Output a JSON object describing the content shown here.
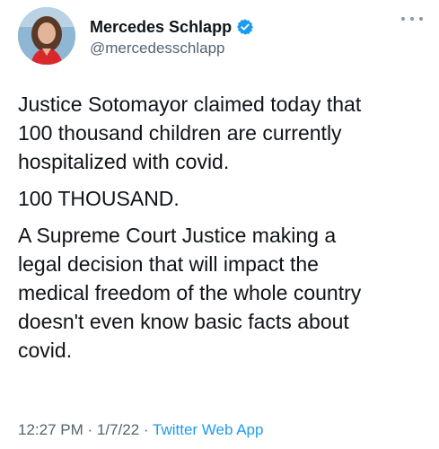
{
  "author": {
    "display_name": "Mercedes Schlapp",
    "handle": "@mercedesschlapp",
    "verified_icon": "verified-badge-icon",
    "verified_color": "#1d9bf0"
  },
  "more_icon": "more-options-icon",
  "tweet": {
    "paragraphs": [
      "Justice Sotomayor claimed today that\n100 thousand children are currently\nhospitalized with covid.",
      "100 THOUSAND.",
      "A Supreme Court Justice making a\nlegal decision that will impact the\nmedical freedom of the whole country\ndoesn't even know basic facts about\ncovid."
    ]
  },
  "meta": {
    "time": "12:27 PM",
    "separator": "·",
    "date": "1/7/22",
    "source": "Twitter Web App"
  },
  "colors": {
    "text": "#0f1419",
    "secondary": "#536471",
    "accent": "#1d9bf0"
  }
}
